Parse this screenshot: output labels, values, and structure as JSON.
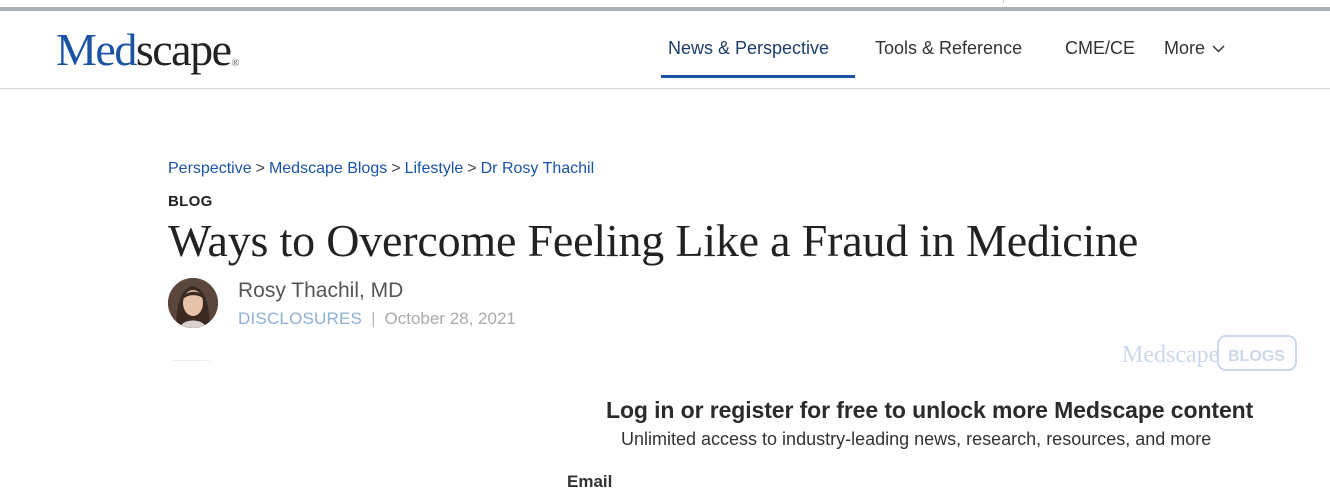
{
  "logo": {
    "part1": "Med",
    "part2": "scape",
    "reg_mark": "®"
  },
  "nav": {
    "items": [
      {
        "label": "News & Perspective",
        "active": true
      },
      {
        "label": "Tools & Reference"
      },
      {
        "label": "CME/CE"
      },
      {
        "label": "More",
        "icon": "chevron-down-icon"
      }
    ]
  },
  "breadcrumb": {
    "items": [
      "Perspective",
      "Medscape Blogs",
      "Lifestyle",
      "Dr Rosy Thachil"
    ],
    "separator": ">"
  },
  "article": {
    "kicker": "BLOG",
    "title": "Ways to Overcome Feeling Like a Fraud in Medicine",
    "author": "Rosy Thachil, MD",
    "disclosures": "DISCLOSURES",
    "separator": "|",
    "date": "October 28, 2021"
  },
  "blogs_badge": {
    "brand": "Medscape",
    "label": "BLOGS"
  },
  "gate": {
    "title": "Log in or register for free to unlock more Medscape content",
    "subtitle": "Unlimited access to industry-leading news, research, resources, and more",
    "email_label": "Email"
  },
  "colors": {
    "brand_blue": "#1b54a4",
    "nav_active": "#1e3d6b",
    "disclosures": "#8fb0d6"
  }
}
